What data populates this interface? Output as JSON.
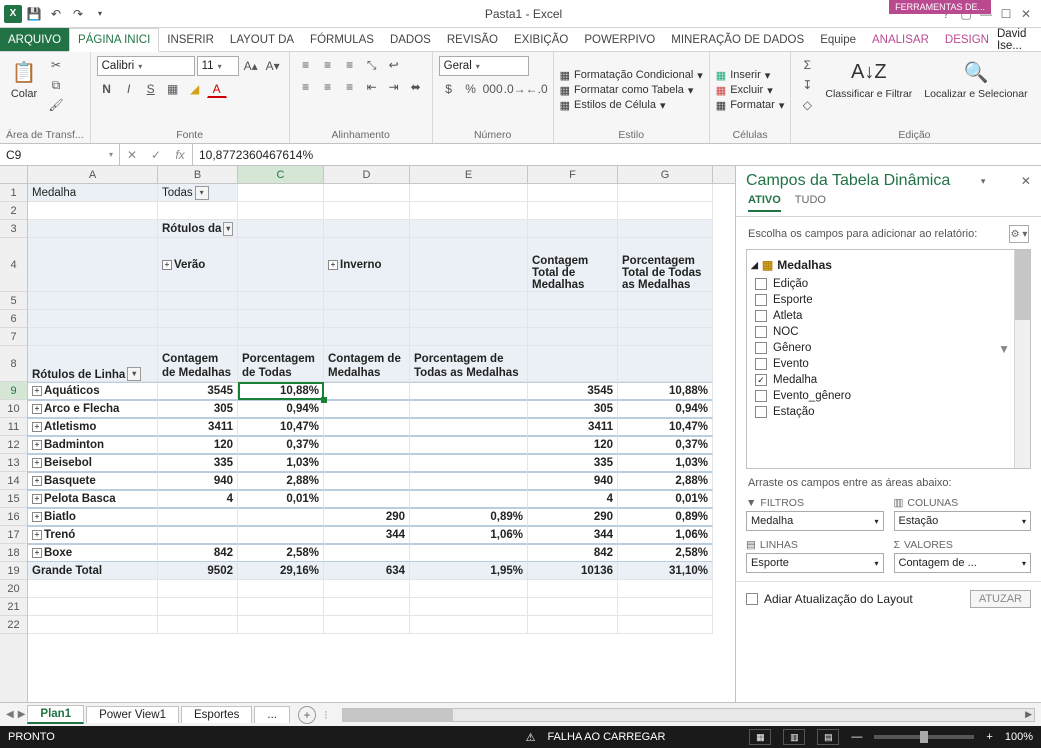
{
  "app": {
    "title": "Pasta1 - Excel",
    "context_tool": "FERRAMENTAS DE..."
  },
  "qat": {
    "save": "save-icon",
    "undo": "undo-icon",
    "redo": "redo-icon",
    "touch": "touch-icon"
  },
  "tabs": {
    "file": "ARQUIVO",
    "home": "PÁGINA INICI",
    "insert": "INSERIR",
    "layout": "LAYOUT DA",
    "formulas": "FÓRMULAS",
    "data": "DADOS",
    "review": "REVISÃO",
    "view": "EXIBIÇÃO",
    "powerpivo": "POWERPIVO",
    "datamining": "MINERAÇÃO DE DADOS",
    "team": "Equipe",
    "analyze": "ANALISAR",
    "design": "DESIGN",
    "user": "David Ise..."
  },
  "ribbon": {
    "clipboard": {
      "paste": "Colar",
      "label": "Área de Transf..."
    },
    "font": {
      "name": "Calibri",
      "size": "11",
      "label": "Fonte",
      "bold": "N",
      "italic": "I",
      "underline": "S"
    },
    "alignment": {
      "label": "Alinhamento"
    },
    "number": {
      "format": "Geral",
      "label": "Número"
    },
    "styles": {
      "cond": "Formatação Condicional",
      "table": "Formatar como Tabela",
      "cell": "Estilos de Célula",
      "label": "Estilo"
    },
    "cells": {
      "insert": "Inserir",
      "delete": "Excluir",
      "format": "Formatar",
      "label": "Células"
    },
    "editing": {
      "sort": "Classificar e Filtrar",
      "find": "Localizar e Selecionar",
      "label": "Edição"
    }
  },
  "fx": {
    "namebox": "C9",
    "formula": "10,8772360467614%"
  },
  "columns": [
    "A",
    "B",
    "C",
    "D",
    "E",
    "F",
    "G"
  ],
  "sheet": {
    "r1": {
      "a": "Medalha",
      "b": "Todas"
    },
    "r3": {
      "b": "Rótulos da"
    },
    "r4": {
      "b": "Verão",
      "d": "Inverno",
      "f": "Contagem Total de Medalhas",
      "g": "Porcentagem Total de Todas as Medalhas"
    },
    "r8": {
      "a": "Rótulos de Linha",
      "b": "Contagem de Medalhas",
      "c": "Porcentagem de Todas",
      "d": "Contagem de Medalhas",
      "e": "Porcentagem de Todas as Medalhas"
    },
    "rows": [
      {
        "n": 9,
        "a": "Aquáticos",
        "b": "3545",
        "c": "10,88%",
        "d": "",
        "e": "",
        "f": "3545",
        "g": "10,88%"
      },
      {
        "n": 10,
        "a": "Arco e Flecha",
        "b": "305",
        "c": "0,94%",
        "d": "",
        "e": "",
        "f": "305",
        "g": "0,94%"
      },
      {
        "n": 11,
        "a": "Atletismo",
        "b": "3411",
        "c": "10,47%",
        "d": "",
        "e": "",
        "f": "3411",
        "g": "10,47%"
      },
      {
        "n": 12,
        "a": "Badminton",
        "b": "120",
        "c": "0,37%",
        "d": "",
        "e": "",
        "f": "120",
        "g": "0,37%"
      },
      {
        "n": 13,
        "a": "Beisebol",
        "b": "335",
        "c": "1,03%",
        "d": "",
        "e": "",
        "f": "335",
        "g": "1,03%"
      },
      {
        "n": 14,
        "a": "Basquete",
        "b": "940",
        "c": "2,88%",
        "d": "",
        "e": "",
        "f": "940",
        "g": "2,88%"
      },
      {
        "n": 15,
        "a": "Pelota Basca",
        "b": "4",
        "c": "0,01%",
        "d": "",
        "e": "",
        "f": "4",
        "g": "0,01%"
      },
      {
        "n": 16,
        "a": "Biatlo",
        "b": "",
        "c": "",
        "d": "290",
        "e": "0,89%",
        "f": "290",
        "g": "0,89%"
      },
      {
        "n": 17,
        "a": "Trenó",
        "b": "",
        "c": "",
        "d": "344",
        "e": "1,06%",
        "f": "344",
        "g": "1,06%"
      },
      {
        "n": 18,
        "a": "Boxe",
        "b": "842",
        "c": "2,58%",
        "d": "",
        "e": "",
        "f": "842",
        "g": "2,58%"
      }
    ],
    "grand": {
      "n": 19,
      "a": "Grande Total",
      "b": "9502",
      "c": "29,16%",
      "d": "634",
      "e": "1,95%",
      "f": "10136",
      "g": "31,10%"
    }
  },
  "sheets": {
    "s1": "Plan1",
    "s2": "Power View1",
    "s3": "Esportes",
    "more": "..."
  },
  "status": {
    "ready": "PRONTO",
    "fail": "FALHA AO CARREGAR",
    "zoom": "100%"
  },
  "taskpane": {
    "title": "Campos da Tabela Dinâmica",
    "tab_active": "ATIVO",
    "tab_all": "TUDO",
    "choose": "Escolha os campos para adicionar ao relatório:",
    "table": "Medalhas",
    "fields": [
      {
        "name": "Edição",
        "checked": false
      },
      {
        "name": "Esporte",
        "checked": false
      },
      {
        "name": "Atleta",
        "checked": false
      },
      {
        "name": "NOC",
        "checked": false
      },
      {
        "name": "Gênero",
        "checked": false
      },
      {
        "name": "Evento",
        "checked": false
      },
      {
        "name": "Medalha",
        "checked": true
      },
      {
        "name": "Evento_gênero",
        "checked": false
      },
      {
        "name": "Estação",
        "checked": false
      }
    ],
    "drag": "Arraste os campos entre as áreas abaixo:",
    "areas": {
      "filters": {
        "label": "FILTROS",
        "value": "Medalha"
      },
      "columns": {
        "label": "COLUNAS",
        "value": "Estação"
      },
      "rows": {
        "label": "LINHAS",
        "value": "Esporte"
      },
      "values": {
        "label": "VALORES",
        "value": "Contagem de ..."
      }
    },
    "defer": "Adiar Atualização do Layout",
    "update": "ATUZAR"
  }
}
